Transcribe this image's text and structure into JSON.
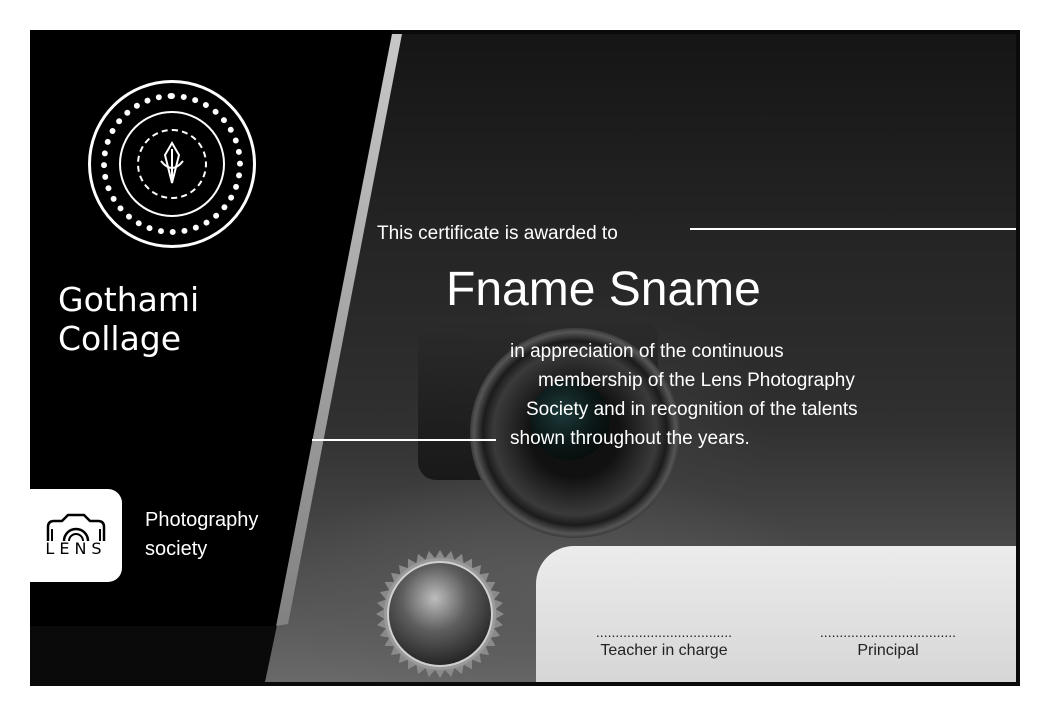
{
  "college": {
    "name": "Gothami Collage"
  },
  "badge": {
    "word": "LENS",
    "icon": "camera-icon"
  },
  "society": {
    "label": "Photography society"
  },
  "certificate": {
    "awarded_text": "This certificate is awarded to",
    "recipient": "Fname Sname",
    "appreciation_lines": [
      "in appreciation of the continuous",
      "membership of the Lens Photography",
      "Society and in recognition of the talents",
      "shown throughout the years."
    ]
  },
  "signatures": {
    "dots": "...................................",
    "teacher": "Teacher in charge",
    "principal": "Principal"
  },
  "colors": {
    "background": "#000000",
    "text": "#ffffff",
    "panel": "#dedede"
  }
}
